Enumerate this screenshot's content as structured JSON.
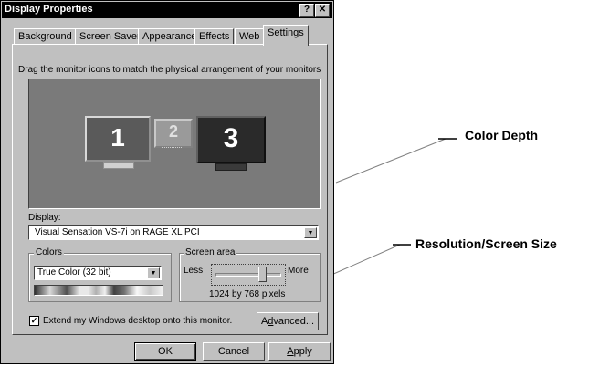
{
  "window": {
    "title": "Display Properties",
    "help_button": "?",
    "close_button": "✕"
  },
  "tabs": [
    {
      "label": "Background"
    },
    {
      "label": "Screen Saver"
    },
    {
      "label": "Appearance"
    },
    {
      "label": "Effects"
    },
    {
      "label": "Web"
    },
    {
      "label": "Settings"
    }
  ],
  "settings": {
    "instruction": "Drag the monitor icons to match the physical arrangement of your monitors",
    "monitors": [
      {
        "number": "1"
      },
      {
        "number": "2"
      },
      {
        "number": "3"
      }
    ],
    "display_label": "Display:",
    "display_value": "Visual Sensation VS-7i on RAGE XL PCI",
    "colors_group_title": "Colors",
    "colors_value": "True Color (32 bit)",
    "screen_area_title": "Screen area",
    "less_label": "Less",
    "more_label": "More",
    "resolution_text": "1024 by 768 pixels",
    "slider_level": 0.75,
    "extend_checked": true,
    "extend_label": "Extend my Windows desktop onto this monitor.",
    "advanced_button": {
      "prefix": "A",
      "underline": "d",
      "rest": "vanced..."
    }
  },
  "buttons": {
    "ok": "OK",
    "cancel": "Cancel",
    "apply": {
      "underline": "A",
      "rest": "pply"
    }
  },
  "callouts": {
    "color_depth": "Color Depth",
    "resolution": "Resolution/Screen Size"
  },
  "colors": {
    "title_bar": "#000000",
    "window_face": "#c0c0c0",
    "monitor_area": "#7a7a7a"
  }
}
